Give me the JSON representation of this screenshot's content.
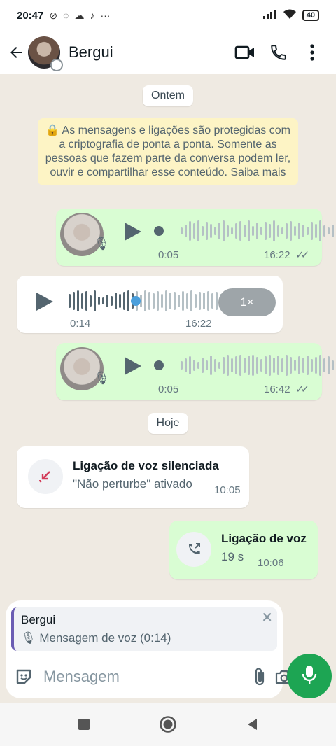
{
  "status_bar": {
    "time": "20:47",
    "battery": "40"
  },
  "header": {
    "contact_name": "Bergui"
  },
  "chat": {
    "date_yesterday": "Ontem",
    "encryption_notice": "As mensagens e ligações são protegidas com a criptografia de ponta a ponta. Somente as pessoas que fazem parte da conversa podem ler, ouvir e compartilhar esse conteúdo. Saiba mais",
    "voice1": {
      "duration": "0:05",
      "time": "16:22"
    },
    "voice2": {
      "duration": "0:14",
      "time": "16:22",
      "speed": "1×",
      "progress": 0.38
    },
    "voice3": {
      "duration": "0:05",
      "time": "16:42"
    },
    "date_today": "Hoje",
    "missed_call": {
      "title": "Ligação de voz silenciada",
      "subtitle": "\"Não perturbe\" ativado",
      "time": "10:05"
    },
    "outgoing_call": {
      "title": "Ligação de voz",
      "subtitle": "19 s",
      "time": "10:06"
    }
  },
  "composer": {
    "reply_name": "Bergui",
    "reply_text": "Mensagem de voz (0:14)",
    "placeholder": "Mensagem"
  },
  "colors": {
    "accent": "#1da553",
    "outgoing_bubble": "#d9fdd3",
    "reply_bar": "#6b5db3",
    "call_missed_icon": "#d33d5a"
  }
}
